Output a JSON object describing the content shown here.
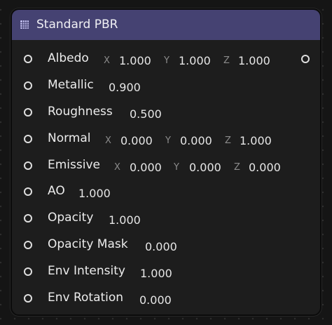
{
  "node": {
    "title": "Standard PBR",
    "header_icon": "grid-icon",
    "header_color": "#454272"
  },
  "rows": [
    {
      "label": "Albedo",
      "x": "X",
      "x_value": "1.000",
      "y": "Y",
      "y_value": "1.000",
      "z": "Z",
      "z_value": "1.000"
    },
    {
      "label": "Metallic",
      "value": "0.900"
    },
    {
      "label": "Roughness",
      "value": "0.500"
    },
    {
      "label": "Normal",
      "x": "X",
      "x_value": "0.000",
      "y": "Y",
      "y_value": "0.000",
      "z": "Z",
      "z_value": "1.000"
    },
    {
      "label": "Emissive",
      "x": "X",
      "x_value": "0.000",
      "y": "Y",
      "y_value": "0.000",
      "z": "Z",
      "z_value": "0.000"
    },
    {
      "label": "AO",
      "value": "1.000"
    },
    {
      "label": "Opacity",
      "value": "1.000"
    },
    {
      "label": "Opacity Mask",
      "value": "0.000"
    },
    {
      "label": "Env Intensity",
      "value": "1.000"
    },
    {
      "label": "Env Rotation",
      "value": "0.000"
    }
  ]
}
